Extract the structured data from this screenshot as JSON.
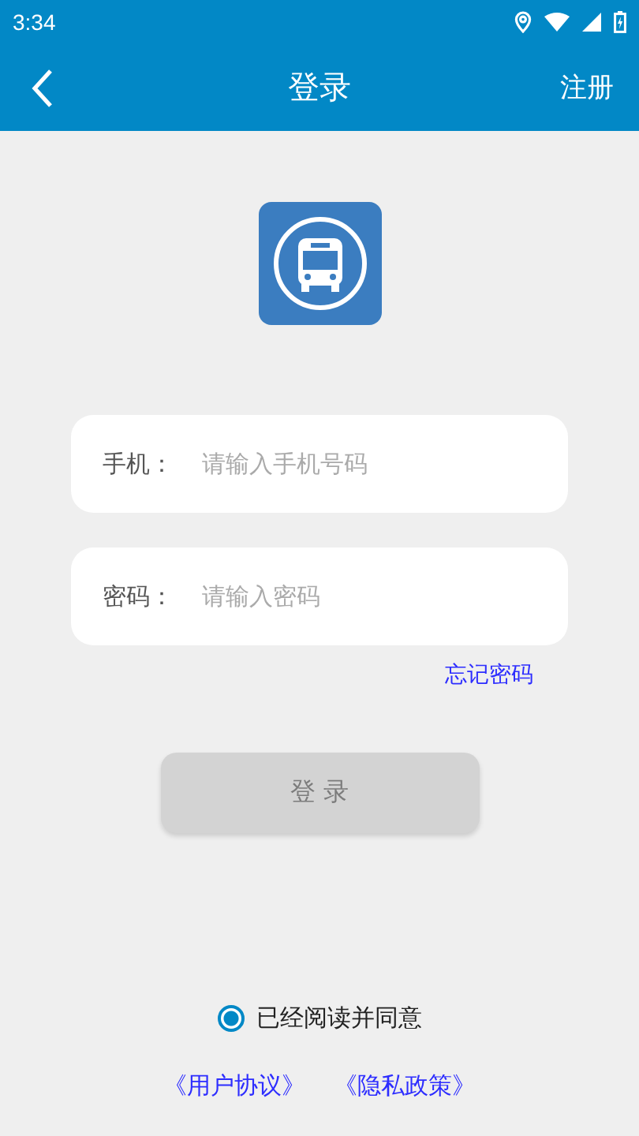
{
  "status_bar": {
    "time": "3:34"
  },
  "app_bar": {
    "title": "登录",
    "action": "注册"
  },
  "fields": [
    {
      "label": "手机：",
      "placeholder": "请输入手机号码"
    },
    {
      "label": "密码：",
      "placeholder": "请输入密码"
    }
  ],
  "forgot_link": "忘记密码",
  "login_button": {
    "label": "登 录",
    "disabled": true
  },
  "agreement": {
    "label": "已经阅读并同意",
    "checked": true
  },
  "links": [
    "《用户协议》",
    "《隐私政策》"
  ]
}
